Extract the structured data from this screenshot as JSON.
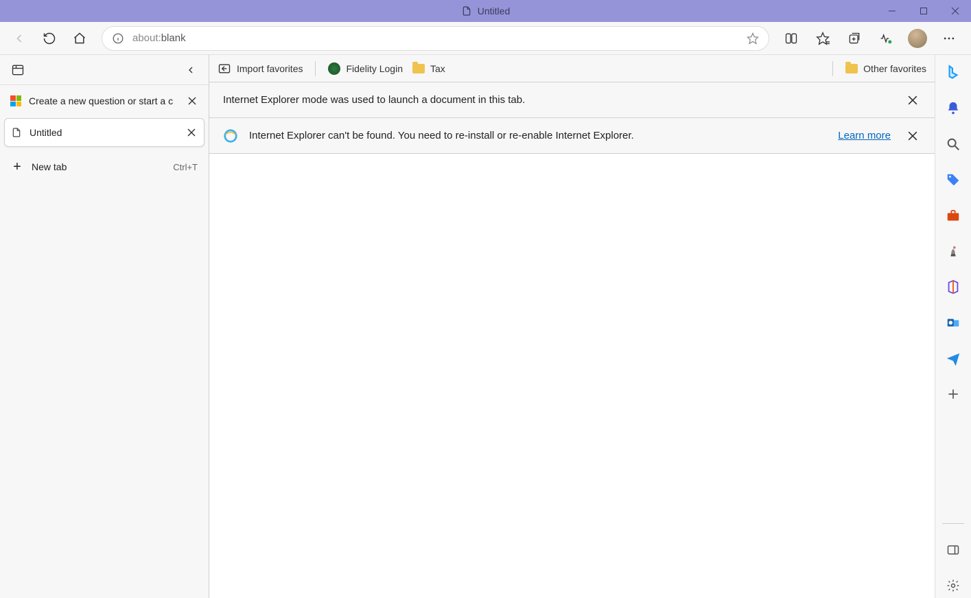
{
  "window": {
    "title": "Untitled"
  },
  "toolbar": {
    "url_prefix": "about:",
    "url_rest": "blank"
  },
  "tabpanel": {
    "tabs": [
      {
        "title": "Create a new question or start a c",
        "icon": "ms"
      },
      {
        "title": "Untitled",
        "icon": "page"
      }
    ],
    "new_tab_label": "New tab",
    "new_tab_shortcut": "Ctrl+T"
  },
  "favbar": {
    "import_label": "Import favorites",
    "items": [
      {
        "label": "Fidelity Login",
        "icon": "fidelity"
      },
      {
        "label": "Tax",
        "icon": "folder"
      }
    ],
    "other_label": "Other favorites"
  },
  "infobars": {
    "ie_mode_msg": "Internet Explorer mode was used to launch a document in this tab.",
    "ie_notfound_msg": "Internet Explorer can't be found. You need to re-install or re-enable Internet Explorer.",
    "learn_more": "Learn more"
  },
  "sidebar": {
    "items": [
      "bing-icon",
      "bell-icon",
      "search-icon",
      "tags-icon",
      "briefcase-icon",
      "chess-icon",
      "m365-icon",
      "outlook-icon",
      "send-icon",
      "plus-icon"
    ]
  }
}
